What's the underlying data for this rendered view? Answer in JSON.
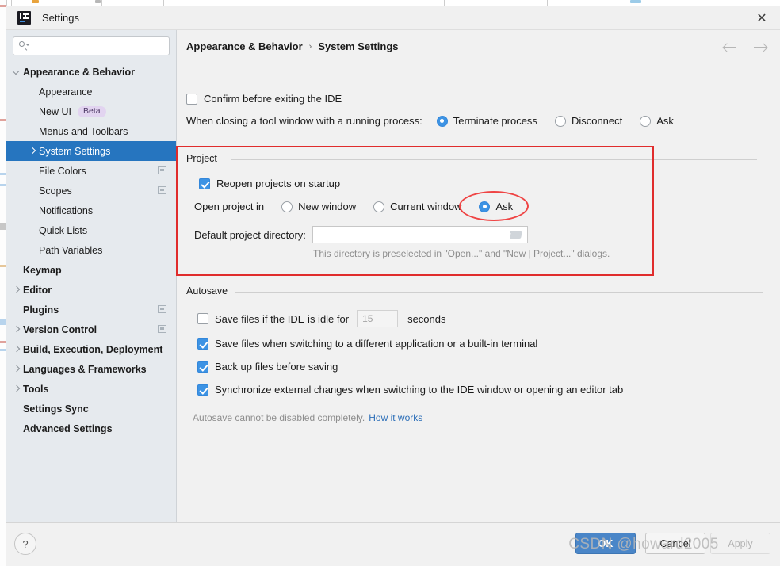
{
  "window": {
    "title": "Settings",
    "app_icon": "intellij-idea-logo",
    "close_label": "✕"
  },
  "search": {
    "value": "",
    "placeholder": "",
    "icon": "search-icon"
  },
  "sidebar": {
    "items": [
      {
        "label": "Appearance & Behavior",
        "indent": 0,
        "arrow": "down",
        "bold": true,
        "selected": false,
        "badge": null,
        "modicon": false
      },
      {
        "label": "Appearance",
        "indent": 1,
        "arrow": "none",
        "bold": false,
        "selected": false,
        "badge": null,
        "modicon": false
      },
      {
        "label": "New UI",
        "indent": 1,
        "arrow": "none",
        "bold": false,
        "selected": false,
        "badge": "Beta",
        "modicon": false
      },
      {
        "label": "Menus and Toolbars",
        "indent": 1,
        "arrow": "none",
        "bold": false,
        "selected": false,
        "badge": null,
        "modicon": false
      },
      {
        "label": "System Settings",
        "indent": 1,
        "arrow": "right",
        "bold": false,
        "selected": true,
        "badge": null,
        "modicon": false
      },
      {
        "label": "File Colors",
        "indent": 1,
        "arrow": "none",
        "bold": false,
        "selected": false,
        "badge": null,
        "modicon": true
      },
      {
        "label": "Scopes",
        "indent": 1,
        "arrow": "none",
        "bold": false,
        "selected": false,
        "badge": null,
        "modicon": true
      },
      {
        "label": "Notifications",
        "indent": 1,
        "arrow": "none",
        "bold": false,
        "selected": false,
        "badge": null,
        "modicon": false
      },
      {
        "label": "Quick Lists",
        "indent": 1,
        "arrow": "none",
        "bold": false,
        "selected": false,
        "badge": null,
        "modicon": false
      },
      {
        "label": "Path Variables",
        "indent": 1,
        "arrow": "none",
        "bold": false,
        "selected": false,
        "badge": null,
        "modicon": false
      },
      {
        "label": "Keymap",
        "indent": 0,
        "arrow": "none",
        "bold": true,
        "selected": false,
        "badge": null,
        "modicon": false
      },
      {
        "label": "Editor",
        "indent": 0,
        "arrow": "right",
        "bold": true,
        "selected": false,
        "badge": null,
        "modicon": false
      },
      {
        "label": "Plugins",
        "indent": 0,
        "arrow": "none",
        "bold": true,
        "selected": false,
        "badge": null,
        "modicon": true
      },
      {
        "label": "Version Control",
        "indent": 0,
        "arrow": "right",
        "bold": true,
        "selected": false,
        "badge": null,
        "modicon": true
      },
      {
        "label": "Build, Execution, Deployment",
        "indent": 0,
        "arrow": "right",
        "bold": true,
        "selected": false,
        "badge": null,
        "modicon": false
      },
      {
        "label": "Languages & Frameworks",
        "indent": 0,
        "arrow": "right",
        "bold": true,
        "selected": false,
        "badge": null,
        "modicon": false
      },
      {
        "label": "Tools",
        "indent": 0,
        "arrow": "right",
        "bold": true,
        "selected": false,
        "badge": null,
        "modicon": false
      },
      {
        "label": "Settings Sync",
        "indent": 0,
        "arrow": "none",
        "bold": true,
        "selected": false,
        "badge": null,
        "modicon": false
      },
      {
        "label": "Advanced Settings",
        "indent": 0,
        "arrow": "none",
        "bold": true,
        "selected": false,
        "badge": null,
        "modicon": false
      }
    ]
  },
  "breadcrumb": {
    "parent": "Appearance & Behavior",
    "separator": "›",
    "current": "System Settings"
  },
  "nav": {
    "back_icon": "arrow-left-icon",
    "forward_icon": "arrow-right-icon"
  },
  "main": {
    "confirm_exit": {
      "label": "Confirm before exiting the IDE",
      "checked": false
    },
    "closing_tool_window": {
      "label": "When closing a tool window with a running process:",
      "options": [
        {
          "label": "Terminate process",
          "selected": true
        },
        {
          "label": "Disconnect",
          "selected": false
        },
        {
          "label": "Ask",
          "selected": false
        }
      ]
    },
    "project_group": {
      "title": "Project",
      "reopen": {
        "label": "Reopen projects on startup",
        "checked": true
      },
      "open_project_in": {
        "label": "Open project in",
        "options": [
          {
            "label": "New window",
            "selected": false
          },
          {
            "label": "Current window",
            "selected": false
          },
          {
            "label": "Ask",
            "selected": true
          }
        ]
      },
      "default_dir": {
        "label": "Default project directory:",
        "value": "",
        "browse_icon": "folder-icon"
      },
      "hint": "This directory is preselected in \"Open...\" and \"New | Project...\" dialogs."
    },
    "autosave_group": {
      "title": "Autosave",
      "idle_save": {
        "label_before": "Save files if the IDE is idle for",
        "value": "15",
        "label_after": "seconds",
        "checked": false
      },
      "checkboxes": [
        {
          "label": "Save files when switching to a different application or a built-in terminal",
          "checked": true
        },
        {
          "label": "Back up files before saving",
          "checked": true
        },
        {
          "label": "Synchronize external changes when switching to the IDE window or opening an editor tab",
          "checked": true
        }
      ],
      "footnote": "Autosave cannot be disabled completely.",
      "footnote_link": "How it works"
    }
  },
  "footer": {
    "help_label": "?",
    "ok_label": "OK",
    "cancel_label": "Cancel",
    "apply_label": "Apply"
  },
  "watermark": {
    "text": "CSDN @howard2005"
  },
  "colors": {
    "accent": "#2675bf",
    "primary_button": "#4a86c8",
    "check_blue": "#3d93e4",
    "annotation_red": "#e02c2c",
    "badge_bg": "#e2d4f0",
    "sidebar_bg": "#e6eaee"
  }
}
